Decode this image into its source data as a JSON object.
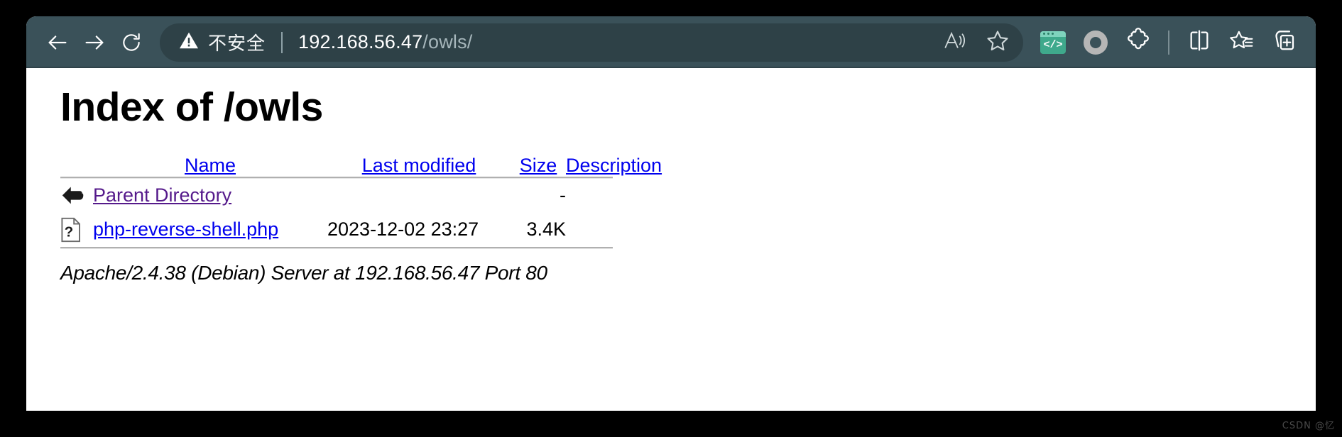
{
  "browser": {
    "nav": {
      "back_label": "Back",
      "forward_label": "Forward",
      "refresh_label": "Refresh"
    },
    "address_bar": {
      "security_icon": "warning-triangle-icon",
      "security_label": "不安全",
      "url_host": "192.168.56.47",
      "url_path": "/owls/",
      "url_full": "192.168.56.47/owls/",
      "read_aloud_label": "Read aloud",
      "favorite_label": "Add this page to favorites"
    },
    "toolbar_right": [
      {
        "name": "devtools-badge-icon",
        "label": "Developer tools",
        "code_glyph": "</>"
      },
      {
        "name": "copilot-circle-icon",
        "label": "Copilot"
      },
      {
        "name": "extensions-puzzle-icon",
        "label": "Extensions"
      },
      {
        "name": "split-screen-icon",
        "label": "Split screen"
      },
      {
        "name": "favorites-list-icon",
        "label": "Favorites"
      },
      {
        "name": "collections-add-icon",
        "label": "Collections"
      }
    ]
  },
  "page": {
    "title": "Index of /owls",
    "headers": {
      "name": "Name",
      "last_modified": "Last modified",
      "size": "Size",
      "description": "Description"
    },
    "rows": [
      {
        "icon": "back-arrow-icon",
        "name": "Parent Directory",
        "visited": true,
        "last_modified": "",
        "size": "-",
        "description": ""
      },
      {
        "icon": "unknown-file-icon",
        "name": "php-reverse-shell.php",
        "visited": false,
        "last_modified": "2023-12-02 23:27",
        "size": "3.4K",
        "description": ""
      }
    ],
    "footer": "Apache/2.4.38 (Debian) Server at 192.168.56.47 Port 80"
  },
  "watermark": "CSDN @忆",
  "colors": {
    "toolbar_bg": "#3a5159",
    "address_pill_bg": "#2e4147",
    "link": "#0000ee",
    "visited_link": "#551a8b",
    "page_bg": "#ffffff",
    "desktop_bg": "#000000"
  }
}
